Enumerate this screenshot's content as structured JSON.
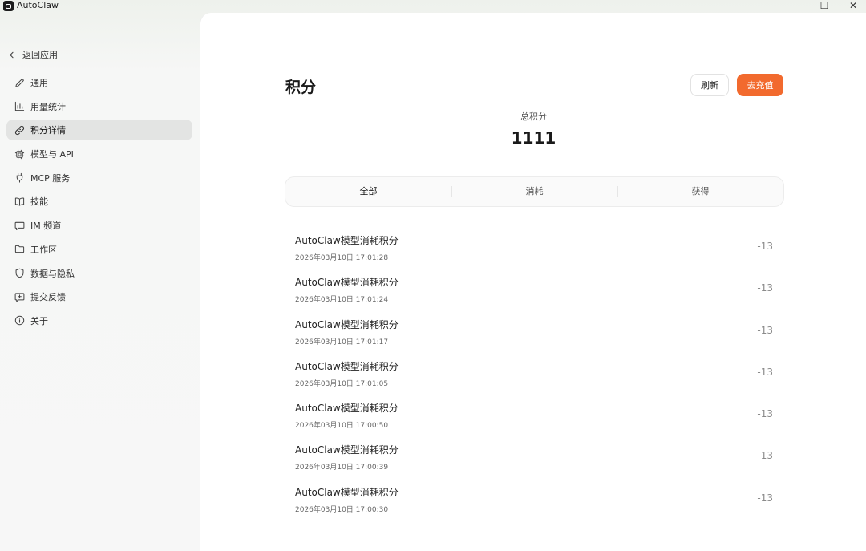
{
  "window": {
    "title": "AutoClaw",
    "controls": {
      "minimize": "—",
      "maximize": "☐",
      "close": "✕"
    }
  },
  "sidebar": {
    "back_label": "返回应用",
    "items": [
      {
        "label": "通用",
        "icon": "pencil-icon"
      },
      {
        "label": "用量统计",
        "icon": "bar-chart-icon"
      },
      {
        "label": "积分详情",
        "icon": "link-icon",
        "active": true
      },
      {
        "label": "模型与 API",
        "icon": "chip-icon"
      },
      {
        "label": "MCP 服务",
        "icon": "plug-icon"
      },
      {
        "label": "技能",
        "icon": "book-icon"
      },
      {
        "label": "IM 频道",
        "icon": "chat-icon"
      },
      {
        "label": "工作区",
        "icon": "folder-icon"
      },
      {
        "label": "数据与隐私",
        "icon": "shield-icon"
      },
      {
        "label": "提交反馈",
        "icon": "feedback-icon"
      },
      {
        "label": "关于",
        "icon": "info-icon"
      }
    ]
  },
  "main": {
    "title": "积分",
    "refresh_label": "刷新",
    "recharge_label": "去充值",
    "total_label": "总积分",
    "total_value": "1111",
    "tabs": [
      {
        "label": "全部",
        "active": true
      },
      {
        "label": "消耗"
      },
      {
        "label": "获得"
      }
    ],
    "records": [
      {
        "title": "AutoClaw模型消耗积分",
        "time": "2026年03月10日 17:01:28",
        "amount": "-13"
      },
      {
        "title": "AutoClaw模型消耗积分",
        "time": "2026年03月10日 17:01:24",
        "amount": "-13"
      },
      {
        "title": "AutoClaw模型消耗积分",
        "time": "2026年03月10日 17:01:17",
        "amount": "-13"
      },
      {
        "title": "AutoClaw模型消耗积分",
        "time": "2026年03月10日 17:01:05",
        "amount": "-13"
      },
      {
        "title": "AutoClaw模型消耗积分",
        "time": "2026年03月10日 17:00:50",
        "amount": "-13"
      },
      {
        "title": "AutoClaw模型消耗积分",
        "time": "2026年03月10日 17:00:39",
        "amount": "-13"
      },
      {
        "title": "AutoClaw模型消耗积分",
        "time": "2026年03月10日 17:00:30",
        "amount": "-13"
      }
    ]
  },
  "colors": {
    "accent": "#f26a2e",
    "active_nav_bg": "#e3e4e3",
    "amount_text": "#8a8a8a"
  }
}
